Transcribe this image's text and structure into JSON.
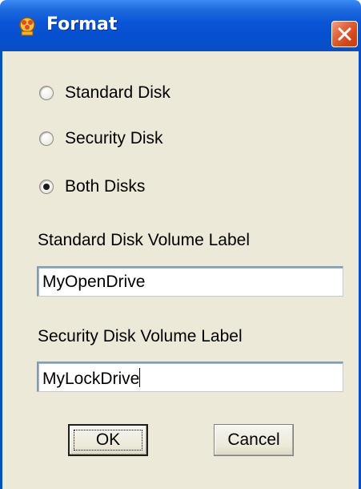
{
  "window": {
    "title": "Format",
    "icon": "app-flower-icon",
    "close_icon": "close-icon"
  },
  "options": [
    {
      "label": "Standard Disk",
      "checked": false
    },
    {
      "label": "Security Disk",
      "checked": false
    },
    {
      "label": "Both Disks",
      "checked": true
    }
  ],
  "standard_label": {
    "caption": "Standard Disk Volume Label",
    "value": "MyOpenDrive"
  },
  "security_label": {
    "caption": "Security Disk Volume Label",
    "value": "MyLockDrive"
  },
  "buttons": {
    "ok": "OK",
    "cancel": "Cancel"
  },
  "colors": {
    "titlebar": "#0a54d6",
    "close_button": "#d2461c",
    "dialog_background": "#ece9d8"
  }
}
